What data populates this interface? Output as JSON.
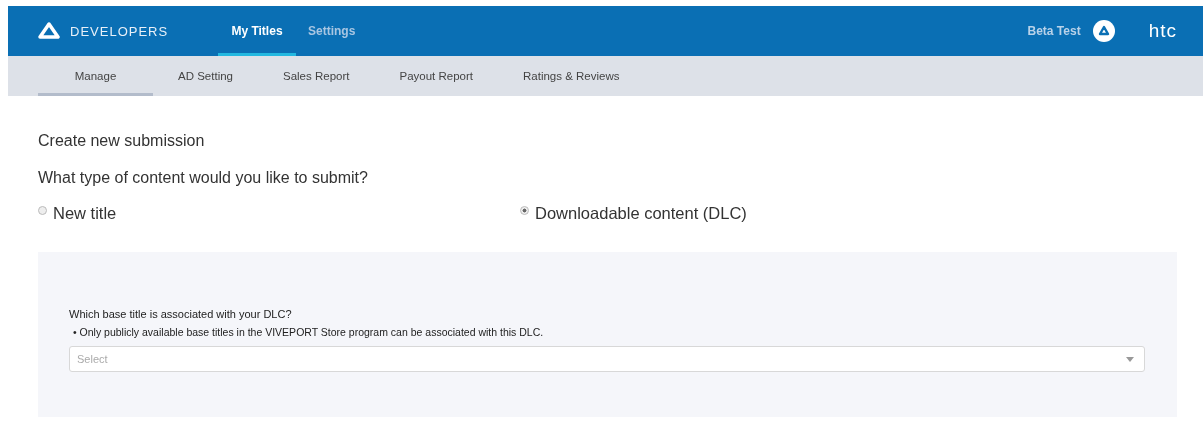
{
  "header": {
    "brand": "DEVELOPERS",
    "nav": [
      {
        "label": "My Titles",
        "selected": true
      },
      {
        "label": "Settings",
        "selected": false
      }
    ],
    "user": "Beta Test",
    "logo_text": "htc"
  },
  "subnav": [
    {
      "label": "Manage",
      "selected": true
    },
    {
      "label": "AD Setting",
      "selected": false
    },
    {
      "label": "Sales Report",
      "selected": false
    },
    {
      "label": "Payout Report",
      "selected": false
    },
    {
      "label": "Ratings & Reviews",
      "selected": false
    }
  ],
  "heading": "Create new submission",
  "question": "What type of content would you like to submit?",
  "options": [
    {
      "label": "New title",
      "selected": false
    },
    {
      "label": "Downloadable content (DLC)",
      "selected": true
    }
  ],
  "panel": {
    "label": "Which base title is associated with your DLC?",
    "note": "• Only publicly available base titles in the VIVEPORT Store program can be associated with this DLC.",
    "select": {
      "placeholder": "Select"
    }
  }
}
